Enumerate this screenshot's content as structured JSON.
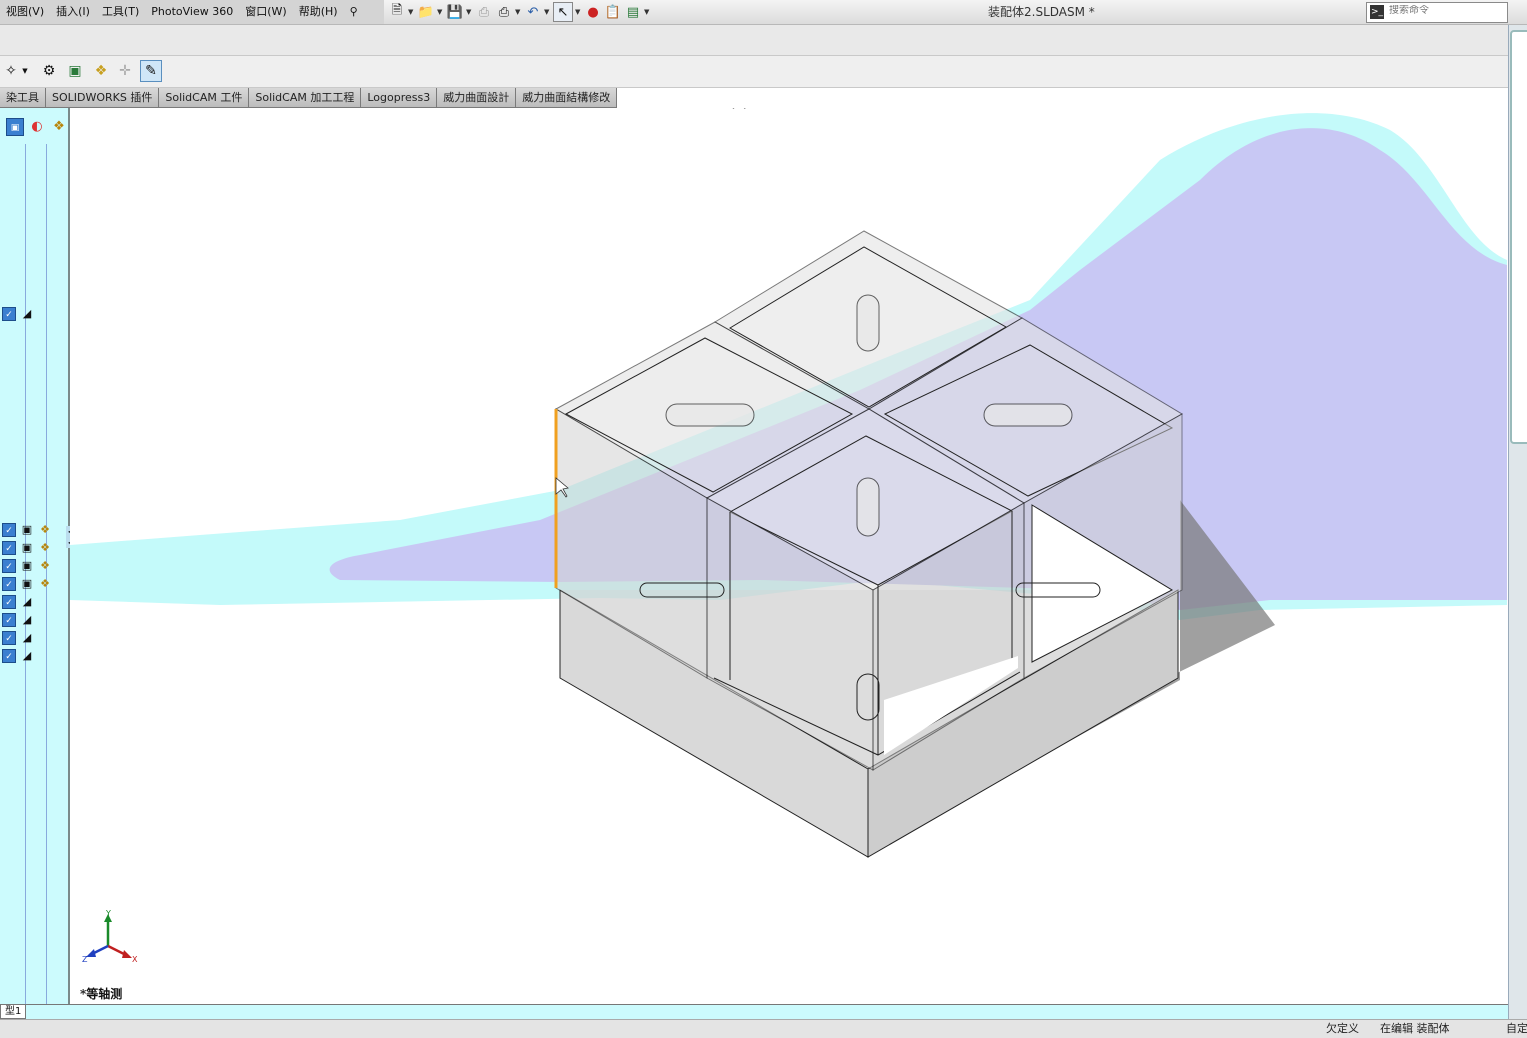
{
  "menubar": {
    "items": [
      "视图(V)",
      "插入(I)",
      "工具(T)",
      "PhotoView 360",
      "窗口(W)",
      "帮助(H)"
    ]
  },
  "title_bar": {
    "document": "装配体2.SLDASM *"
  },
  "search": {
    "placeholder": "搜索命令"
  },
  "command_tabs": [
    "染工具",
    "SOLIDWORKS 插件",
    "SolidCAM 工件",
    "SolidCAM 加工工程",
    "Logopress3",
    "威力曲面設計",
    "威力曲面結構修改"
  ],
  "viewport": {
    "view_orientation": "*等轴测"
  },
  "triad": {
    "x": "X",
    "y": "Y",
    "z": "Z"
  },
  "bottom_tabs": [
    "型1"
  ],
  "status": {
    "under_defined": "欠定义",
    "editing": "在编辑 装配体",
    "custom": "自定"
  },
  "colors": {
    "background": "#ffffff",
    "panel": "#ccfbfd",
    "shadow_lavender": "#c8c8f4",
    "shadow_cyan": "#c4fafa",
    "selection_edge": "#f0a020"
  }
}
